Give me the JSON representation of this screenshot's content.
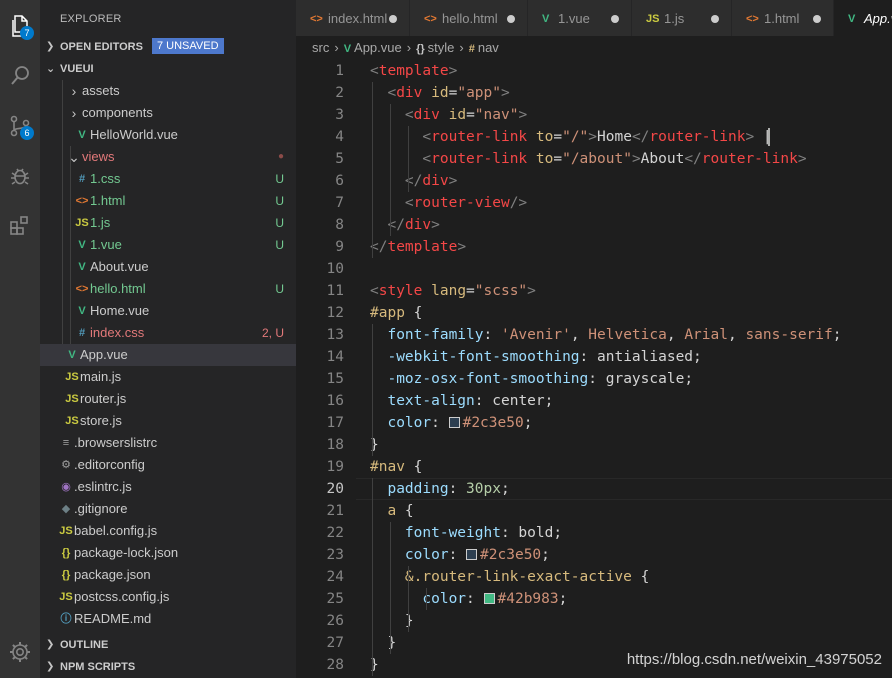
{
  "activity": {
    "explorer_badge": "7",
    "scm_badge": "6"
  },
  "sidebar": {
    "title": "EXPLORER",
    "open_editors": {
      "label": "OPEN EDITORS",
      "unsaved": "7 UNSAVED"
    },
    "project": "VUEUI",
    "tree": [
      {
        "label": "assets",
        "icon": "›",
        "icon_name": "chevron-right-icon",
        "color": "#c5c5c5",
        "status": "",
        "status_color": ""
      },
      {
        "label": "components",
        "icon": "›",
        "icon_name": "chevron-right-icon",
        "color": "#c5c5c5",
        "status": "",
        "status_color": ""
      },
      {
        "label": "HelloWorld.vue",
        "icon": "V",
        "icon_name": "vue-file-icon",
        "color": "#41b883",
        "status": "",
        "status_color": ""
      },
      {
        "label": "views",
        "icon": "⌄",
        "icon_name": "chevron-down-icon",
        "color": "#c5c5c5",
        "status": "●",
        "status_color": "#8b4b48"
      },
      {
        "label": "1.css",
        "icon": "#",
        "icon_name": "css-file-icon",
        "color": "#519aba",
        "status": "U",
        "status_color": "#73c991"
      },
      {
        "label": "1.html",
        "icon": "<>",
        "icon_name": "html-file-icon",
        "color": "#e37933",
        "status": "U",
        "status_color": "#73c991"
      },
      {
        "label": "1.js",
        "icon": "JS",
        "icon_name": "js-file-icon",
        "color": "#cbcb41",
        "status": "U",
        "status_color": "#73c991"
      },
      {
        "label": "1.vue",
        "icon": "V",
        "icon_name": "vue-file-icon",
        "color": "#41b883",
        "status": "U",
        "status_color": "#73c991"
      },
      {
        "label": "About.vue",
        "icon": "V",
        "icon_name": "vue-file-icon",
        "color": "#41b883",
        "status": "",
        "status_color": ""
      },
      {
        "label": "hello.html",
        "icon": "<>",
        "icon_name": "html-file-icon",
        "color": "#e37933",
        "status": "U",
        "status_color": "#73c991"
      },
      {
        "label": "Home.vue",
        "icon": "V",
        "icon_name": "vue-file-icon",
        "color": "#41b883",
        "status": "",
        "status_color": ""
      },
      {
        "label": "index.css",
        "icon": "#",
        "icon_name": "css-file-icon",
        "color": "#519aba",
        "status": "2, U",
        "status_color": "#e2797a"
      },
      {
        "label": "App.vue",
        "icon": "V",
        "icon_name": "vue-file-icon",
        "color": "#41b883",
        "status": "",
        "status_color": ""
      },
      {
        "label": "main.js",
        "icon": "JS",
        "icon_name": "js-file-icon",
        "color": "#cbcb41",
        "status": "",
        "status_color": ""
      },
      {
        "label": "router.js",
        "icon": "JS",
        "icon_name": "js-file-icon",
        "color": "#cbcb41",
        "status": "",
        "status_color": ""
      },
      {
        "label": "store.js",
        "icon": "JS",
        "icon_name": "js-file-icon",
        "color": "#cbcb41",
        "status": "",
        "status_color": ""
      },
      {
        "label": ".browserslistrc",
        "icon": "≡",
        "icon_name": "text-file-icon",
        "color": "#a0a0a0",
        "status": "",
        "status_color": ""
      },
      {
        "label": ".editorconfig",
        "icon": "⚙",
        "icon_name": "config-file-icon",
        "color": "#a0a0a0",
        "status": "",
        "status_color": ""
      },
      {
        "label": ".eslintrc.js",
        "icon": "◉",
        "icon_name": "eslint-file-icon",
        "color": "#a074c4",
        "status": "",
        "status_color": ""
      },
      {
        "label": ".gitignore",
        "icon": "◆",
        "icon_name": "git-file-icon",
        "color": "#6d8086",
        "status": "",
        "status_color": ""
      },
      {
        "label": "babel.config.js",
        "icon": "JS",
        "icon_name": "js-file-icon",
        "color": "#cbcb41",
        "status": "",
        "status_color": ""
      },
      {
        "label": "package-lock.json",
        "icon": "{}",
        "icon_name": "json-file-icon",
        "color": "#cbcb41",
        "status": "",
        "status_color": ""
      },
      {
        "label": "package.json",
        "icon": "{}",
        "icon_name": "json-file-icon",
        "color": "#cbcb41",
        "status": "",
        "status_color": ""
      },
      {
        "label": "postcss.config.js",
        "icon": "JS",
        "icon_name": "js-file-icon",
        "color": "#cbcb41",
        "status": "",
        "status_color": ""
      },
      {
        "label": "README.md",
        "icon": "ⓘ",
        "icon_name": "info-file-icon",
        "color": "#519aba",
        "status": "",
        "status_color": ""
      }
    ],
    "outline": "OUTLINE",
    "npm_scripts": "NPM SCRIPTS"
  },
  "tabs": [
    {
      "label": "index.html",
      "icon": "<>",
      "icon_name": "html-file-icon",
      "color": "#e37933",
      "dirty": true
    },
    {
      "label": "hello.html",
      "icon": "<>",
      "icon_name": "html-file-icon",
      "color": "#e37933",
      "dirty": true
    },
    {
      "label": "1.vue",
      "icon": "V",
      "icon_name": "vue-file-icon",
      "color": "#41b883",
      "dirty": true
    },
    {
      "label": "1.js",
      "icon": "JS",
      "icon_name": "js-file-icon",
      "color": "#cbcb41",
      "dirty": true
    },
    {
      "label": "1.html",
      "icon": "<>",
      "icon_name": "html-file-icon",
      "color": "#e37933",
      "dirty": true
    },
    {
      "label": "App.vue",
      "icon": "V",
      "icon_name": "vue-file-icon",
      "color": "#41b883",
      "dirty": false
    }
  ],
  "breadcrumb": [
    "src",
    "App.vue",
    "style",
    "#nav"
  ],
  "editor": {
    "current_line": 20,
    "lines": [
      "1",
      "2",
      "3",
      "4",
      "5",
      "6",
      "7",
      "8",
      "9",
      "10",
      "11",
      "12",
      "13",
      "14",
      "15",
      "16",
      "17",
      "18",
      "19",
      "20",
      "21",
      "22",
      "23",
      "24",
      "25",
      "26",
      "27",
      "28"
    ],
    "code": [
      [
        [
          "t-br",
          "<"
        ],
        [
          "t-tag",
          "template"
        ],
        [
          "t-br",
          ">"
        ]
      ],
      [
        [
          "t-txt",
          "  "
        ],
        [
          "t-br",
          "<"
        ],
        [
          "t-tag",
          "div"
        ],
        [
          "t-txt",
          " "
        ],
        [
          "t-attr",
          "id"
        ],
        [
          "t-txt",
          "="
        ],
        [
          "t-str",
          "\"app\""
        ],
        [
          "t-br",
          ">"
        ]
      ],
      [
        [
          "t-txt",
          "    "
        ],
        [
          "t-br",
          "<"
        ],
        [
          "t-tag",
          "div"
        ],
        [
          "t-txt",
          " "
        ],
        [
          "t-attr",
          "id"
        ],
        [
          "t-txt",
          "="
        ],
        [
          "t-str",
          "\"nav\""
        ],
        [
          "t-br",
          ">"
        ]
      ],
      [
        [
          "t-txt",
          "      "
        ],
        [
          "t-br",
          "<"
        ],
        [
          "t-tag",
          "router-link"
        ],
        [
          "t-txt",
          " "
        ],
        [
          "t-attr",
          "to"
        ],
        [
          "t-txt",
          "="
        ],
        [
          "t-str",
          "\"/\""
        ],
        [
          "t-br",
          ">"
        ],
        [
          "t-txt",
          "Home"
        ],
        [
          "t-br",
          "</"
        ],
        [
          "t-tag",
          "router-link"
        ],
        [
          "t-br",
          ">"
        ],
        [
          "t-txt",
          " |"
        ]
      ],
      [
        [
          "t-txt",
          "      "
        ],
        [
          "t-br",
          "<"
        ],
        [
          "t-tag",
          "router-link"
        ],
        [
          "t-txt",
          " "
        ],
        [
          "t-attr",
          "to"
        ],
        [
          "t-txt",
          "="
        ],
        [
          "t-str",
          "\"/about\""
        ],
        [
          "t-br",
          ">"
        ],
        [
          "t-txt",
          "About"
        ],
        [
          "t-br",
          "</"
        ],
        [
          "t-tag",
          "router-link"
        ],
        [
          "t-br",
          ">"
        ]
      ],
      [
        [
          "t-txt",
          "    "
        ],
        [
          "t-br",
          "</"
        ],
        [
          "t-tag",
          "div"
        ],
        [
          "t-br",
          ">"
        ]
      ],
      [
        [
          "t-txt",
          "    "
        ],
        [
          "t-br",
          "<"
        ],
        [
          "t-tag",
          "router-view"
        ],
        [
          "t-br",
          "/>"
        ]
      ],
      [
        [
          "t-txt",
          "  "
        ],
        [
          "t-br",
          "</"
        ],
        [
          "t-tag",
          "div"
        ],
        [
          "t-br",
          ">"
        ]
      ],
      [
        [
          "t-br",
          "</"
        ],
        [
          "t-tag",
          "template"
        ],
        [
          "t-br",
          ">"
        ]
      ],
      [],
      [
        [
          "t-br",
          "<"
        ],
        [
          "t-tag",
          "style"
        ],
        [
          "t-txt",
          " "
        ],
        [
          "t-attr",
          "lang"
        ],
        [
          "t-txt",
          "="
        ],
        [
          "t-str",
          "\"scss\""
        ],
        [
          "t-br",
          ">"
        ]
      ],
      [
        [
          "t-sel",
          "#app"
        ],
        [
          "t-pu",
          " {"
        ]
      ],
      [
        [
          "t-txt",
          "  "
        ],
        [
          "t-prop",
          "font-family"
        ],
        [
          "t-pu",
          ": "
        ],
        [
          "t-str",
          "'Avenir'"
        ],
        [
          "t-pu",
          ", "
        ],
        [
          "t-str",
          "Helvetica"
        ],
        [
          "t-pu",
          ", "
        ],
        [
          "t-str",
          "Arial"
        ],
        [
          "t-pu",
          ", "
        ],
        [
          "t-str",
          "sans-serif"
        ],
        [
          "t-pu",
          ";"
        ]
      ],
      [
        [
          "t-txt",
          "  "
        ],
        [
          "t-prop",
          "-webkit-font-smoothing"
        ],
        [
          "t-pu",
          ": "
        ],
        [
          "t-txt",
          "antialiased"
        ],
        [
          "t-pu",
          ";"
        ]
      ],
      [
        [
          "t-txt",
          "  "
        ],
        [
          "t-prop",
          "-moz-osx-font-smoothing"
        ],
        [
          "t-pu",
          ": "
        ],
        [
          "t-txt",
          "grayscale"
        ],
        [
          "t-pu",
          ";"
        ]
      ],
      [
        [
          "t-txt",
          "  "
        ],
        [
          "t-prop",
          "text-align"
        ],
        [
          "t-pu",
          ": "
        ],
        [
          "t-txt",
          "center"
        ],
        [
          "t-pu",
          ";"
        ]
      ],
      [
        [
          "t-txt",
          "  "
        ],
        [
          "t-prop",
          "color"
        ],
        [
          "t-pu",
          ": "
        ],
        [
          "swatch",
          "#2c3e50"
        ],
        [
          "t-str",
          "#2c3e50"
        ],
        [
          "t-pu",
          ";"
        ]
      ],
      [
        [
          "t-pu",
          "}"
        ]
      ],
      [
        [
          "t-sel",
          "#nav"
        ],
        [
          "t-pu",
          " {"
        ]
      ],
      [
        [
          "t-txt",
          "  "
        ],
        [
          "t-prop",
          "padding"
        ],
        [
          "t-pu",
          ": "
        ],
        [
          "t-num",
          "30px"
        ],
        [
          "t-pu",
          ";"
        ]
      ],
      [
        [
          "t-txt",
          "  "
        ],
        [
          "t-sel",
          "a"
        ],
        [
          "t-pu",
          " {"
        ]
      ],
      [
        [
          "t-txt",
          "    "
        ],
        [
          "t-prop",
          "font-weight"
        ],
        [
          "t-pu",
          ": "
        ],
        [
          "t-txt",
          "bold"
        ],
        [
          "t-pu",
          ";"
        ]
      ],
      [
        [
          "t-txt",
          "    "
        ],
        [
          "t-prop",
          "color"
        ],
        [
          "t-pu",
          ": "
        ],
        [
          "swatch",
          "#2c3e50"
        ],
        [
          "t-str",
          "#2c3e50"
        ],
        [
          "t-pu",
          ";"
        ]
      ],
      [
        [
          "t-txt",
          "    "
        ],
        [
          "t-sel",
          "&.router-link-exact-active"
        ],
        [
          "t-pu",
          " {"
        ]
      ],
      [
        [
          "t-txt",
          "      "
        ],
        [
          "t-prop",
          "color"
        ],
        [
          "t-pu",
          ": "
        ],
        [
          "swatch",
          "#42b983"
        ],
        [
          "t-str",
          "#42b983"
        ],
        [
          "t-pu",
          ";"
        ]
      ],
      [
        [
          "t-txt",
          "    "
        ],
        [
          "t-pu",
          "}"
        ]
      ],
      [
        [
          "t-txt",
          "  "
        ],
        [
          "t-pu",
          "}"
        ]
      ],
      [
        [
          "t-pu",
          "}"
        ]
      ]
    ]
  },
  "watermark": "https://blog.csdn.net/weixin_43975052"
}
